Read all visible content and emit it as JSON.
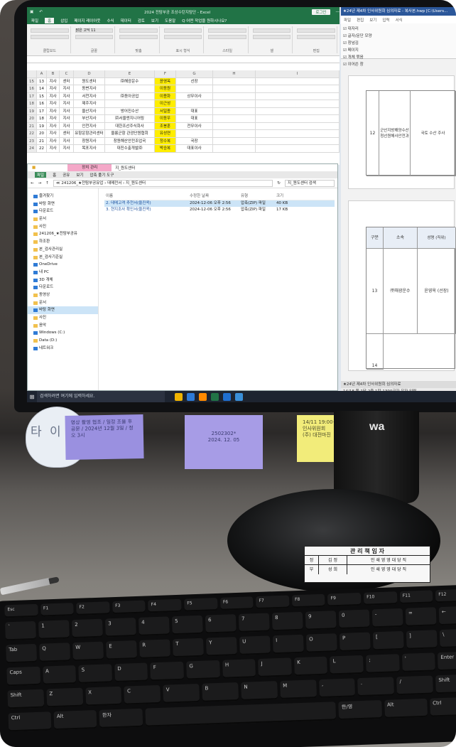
{
  "excel": {
    "title": "2024 전탐부공 조상수탄지탐단 - Excel",
    "login": "로그인",
    "tabs": [
      "파일",
      "홈",
      "삽입",
      "페이지 레이아웃",
      "수식",
      "데이터",
      "검토",
      "보기",
      "도움말",
      "Q 어떤 작업을 원하시나요?"
    ],
    "ribbon_groups": [
      "클립보드",
      "글꼴",
      "맞춤",
      "표시 형식",
      "스타일",
      "셀",
      "편집"
    ],
    "font_name": "맑은 고딕",
    "font_size": "11",
    "col_headers": [
      "",
      "A",
      "B",
      "C",
      "D",
      "E",
      "F",
      "G",
      "H",
      "I"
    ],
    "rows": [
      {
        "n": "15",
        "a": "13",
        "b": "지사",
        "c": "센터",
        "d": "원도센터",
        "e": "㈜해광운수",
        "f": "윤영옥",
        "g": "선장",
        "h": "",
        "i": "",
        "hl": true
      },
      {
        "n": "16",
        "a": "14",
        "b": "지사",
        "c": "지사",
        "d": "동변지사",
        "e": "",
        "f": "이동원",
        "g": "",
        "h": "",
        "i": "",
        "hl": true
      },
      {
        "n": "17",
        "a": "15",
        "b": "지사",
        "c": "지사",
        "d": "서천지사",
        "e": "㈜동아공업",
        "f": "이용화",
        "g": "상무이사",
        "h": "",
        "i": "",
        "hl": true
      },
      {
        "n": "18",
        "a": "16",
        "b": "지사",
        "c": "지사",
        "d": "제주지사",
        "e": "",
        "f": "이근성",
        "g": "",
        "h": "",
        "i": "",
        "hl": true
      },
      {
        "n": "19",
        "a": "17",
        "b": "지사",
        "c": "지사",
        "d": "울산지사",
        "e": "방어진수산",
        "f": "서일종",
        "g": "대표",
        "h": "",
        "i": "",
        "hl": true
      },
      {
        "n": "20",
        "a": "18",
        "b": "지사",
        "c": "지사",
        "d": "부산지사",
        "e": "㈜서울엔지니어링",
        "f": "이동우",
        "g": "대표",
        "h": "",
        "i": "",
        "hl": true
      },
      {
        "n": "21",
        "a": "19",
        "b": "지사",
        "c": "지사",
        "d": "인천지사",
        "e": "대한조선주식회사",
        "f": "조봉훈",
        "g": "전무이사",
        "h": "",
        "i": "",
        "hl": true
      },
      {
        "n": "22",
        "a": "20",
        "b": "지사",
        "c": "센터",
        "d": "유항운항관리센터",
        "e": "울릉군항 관광단원협회",
        "f": "유성연",
        "g": "",
        "h": "",
        "i": "",
        "hl": true
      },
      {
        "n": "23",
        "a": "21",
        "b": "지사",
        "c": "지사",
        "d": "창원지사",
        "e": "창원해산안전조업국",
        "f": "정수복",
        "g": "국장",
        "h": "",
        "i": "",
        "hl": true
      },
      {
        "n": "24",
        "a": "22",
        "b": "지사",
        "c": "지사",
        "d": "목포지사",
        "e": "대진수출개발㈜",
        "f": "박승복",
        "g": "대표이사",
        "h": "",
        "i": "",
        "hl": true
      }
    ]
  },
  "explorer": {
    "manage_tab": "장치 관리",
    "tab_label": "지_원도센터",
    "tabs": [
      "파일",
      "홈",
      "공유",
      "보기",
      "압축 풀기 도구"
    ],
    "address": "≪ 241206_★전탐부공유업 › 데메전서 › 지_원도센터",
    "search": "지_원도센터 검색",
    "nav_items": [
      {
        "label": "즐겨찾기",
        "sel": false,
        "blue": true
      },
      {
        "label": "바탕 화면",
        "sel": false,
        "blue": true
      },
      {
        "label": "다운로드",
        "sel": false,
        "blue": true
      },
      {
        "label": "문서",
        "sel": false,
        "blue": false
      },
      {
        "label": "사진",
        "sel": false,
        "blue": false
      },
      {
        "label": "241206_★전탐부공유",
        "sel": false,
        "blue": false
      },
      {
        "label": "하조환",
        "sel": false,
        "blue": false
      },
      {
        "label": "본_검사관리실",
        "sel": false,
        "blue": false
      },
      {
        "label": "본_검사기준실",
        "sel": false,
        "blue": false
      },
      {
        "label": "OneDrive",
        "sel": false,
        "blue": true
      },
      {
        "label": "내 PC",
        "sel": false,
        "blue": true
      },
      {
        "label": "3D 개체",
        "sel": false,
        "blue": true
      },
      {
        "label": "다운로드",
        "sel": false,
        "blue": true
      },
      {
        "label": "동영상",
        "sel": false,
        "blue": false
      },
      {
        "label": "문서",
        "sel": false,
        "blue": false
      },
      {
        "label": "바탕 화면",
        "sel": true,
        "blue": true
      },
      {
        "label": "사진",
        "sel": false,
        "blue": false
      },
      {
        "label": "음악",
        "sel": false,
        "blue": false
      },
      {
        "label": "Windows (C:)",
        "sel": false,
        "blue": true
      },
      {
        "label": "Data (D:)",
        "sel": false,
        "blue": false
      },
      {
        "label": "네트워크",
        "sel": false,
        "blue": true
      }
    ],
    "file_headers": [
      "이름",
      "수정한 날짜",
      "유형",
      "크기"
    ],
    "files": [
      {
        "name": "2. 데메고객 추천서(울진콕)",
        "date": "2024-12-06 오후 2:56",
        "type": "압축(ZIP) 파일",
        "size": "40 KB",
        "sel": true
      },
      {
        "name": "3. 현지조사 확인서(울진콕)",
        "date": "2024-12-06 오후 2:56",
        "type": "압축(ZIP) 파일",
        "size": "17 KB",
        "sel": false
      }
    ]
  },
  "word": {
    "title": "★24년 제4차 인사위원회 심의자료 - 복사본.hwp [C:\\Users...",
    "tabs": [
      "파일",
      "편집",
      "보기",
      "입력",
      "서식"
    ],
    "ribbon": [
      "☑ 대자리",
      "☑ 글자/문단 모양",
      "☑ 창넘김",
      "☑ 페이지",
      "☑ 개체 묶음",
      "☑ 이어쓴 창"
    ],
    "cell_no1": "12",
    "cell_org1": "군산지방해양수산청선원해사안전과",
    "cell_rest1": "국토 수산 주사",
    "header_gubun": "구분",
    "header_sosok": "소속",
    "header_name": "성명 (직위)",
    "cell_no2": "13",
    "cell_org2": "㈜해광운수",
    "cell_name2": "윤영옥 (선장)",
    "cell_no3": "14",
    "page_tab": "★24년 제4차 인사위원회 심의자료",
    "status": "14/18 쪽 1단 2줄 1칸 1390글자 문자 입력 ..."
  },
  "taskbar": {
    "search": "검색하려면 여기에 입력하세요."
  },
  "notes": [
    {
      "text": "영상 촬영 협조 / 일정 조율 후 공문 / 2024년 12월 3일 / 정오 3시",
      "bg": "#9a90e0"
    },
    {
      "text": "2502302*\n2024. 12. 05",
      "bg": "#a79ce6"
    },
    {
      "text": "14/11 19:00~\n인사위원회\n(주) 대전마진",
      "bg": "#f2ec7a"
    }
  ],
  "mascot_text": "타 이 성",
  "brand": "wa",
  "stand_label": {
    "title": "관 리 책 임 자",
    "rows": [
      [
        "정",
        "김 정",
        "인 쇄 영 영 대 당 직"
      ],
      [
        "부",
        "성 희",
        "인 쇄 영 영 대 당 직"
      ]
    ]
  },
  "keyboard": {
    "fkeys": [
      "Esc",
      "F1",
      "F2",
      "F3",
      "F4",
      "F5",
      "F6",
      "F7",
      "F8",
      "F9",
      "F10",
      "F11",
      "F12"
    ],
    "row1": [
      "`",
      "1",
      "2",
      "3",
      "4",
      "5",
      "6",
      "7",
      "8",
      "9",
      "0",
      "-",
      "=",
      "←"
    ],
    "row2": [
      "Tab",
      "Q",
      "W",
      "E",
      "R",
      "T",
      "Y",
      "U",
      "I",
      "O",
      "P",
      "[",
      "]",
      "\\"
    ],
    "row3": [
      "Caps",
      "A",
      "S",
      "D",
      "F",
      "G",
      "H",
      "J",
      "K",
      "L",
      ";",
      "'",
      "Enter"
    ],
    "row4": [
      "Shift",
      "Z",
      "X",
      "C",
      "V",
      "B",
      "N",
      "M",
      ",",
      ".",
      "/",
      "Shift"
    ],
    "row5": [
      "Ctrl",
      "Alt",
      "한자",
      "",
      "한/영",
      "Alt",
      "Ctrl"
    ]
  }
}
